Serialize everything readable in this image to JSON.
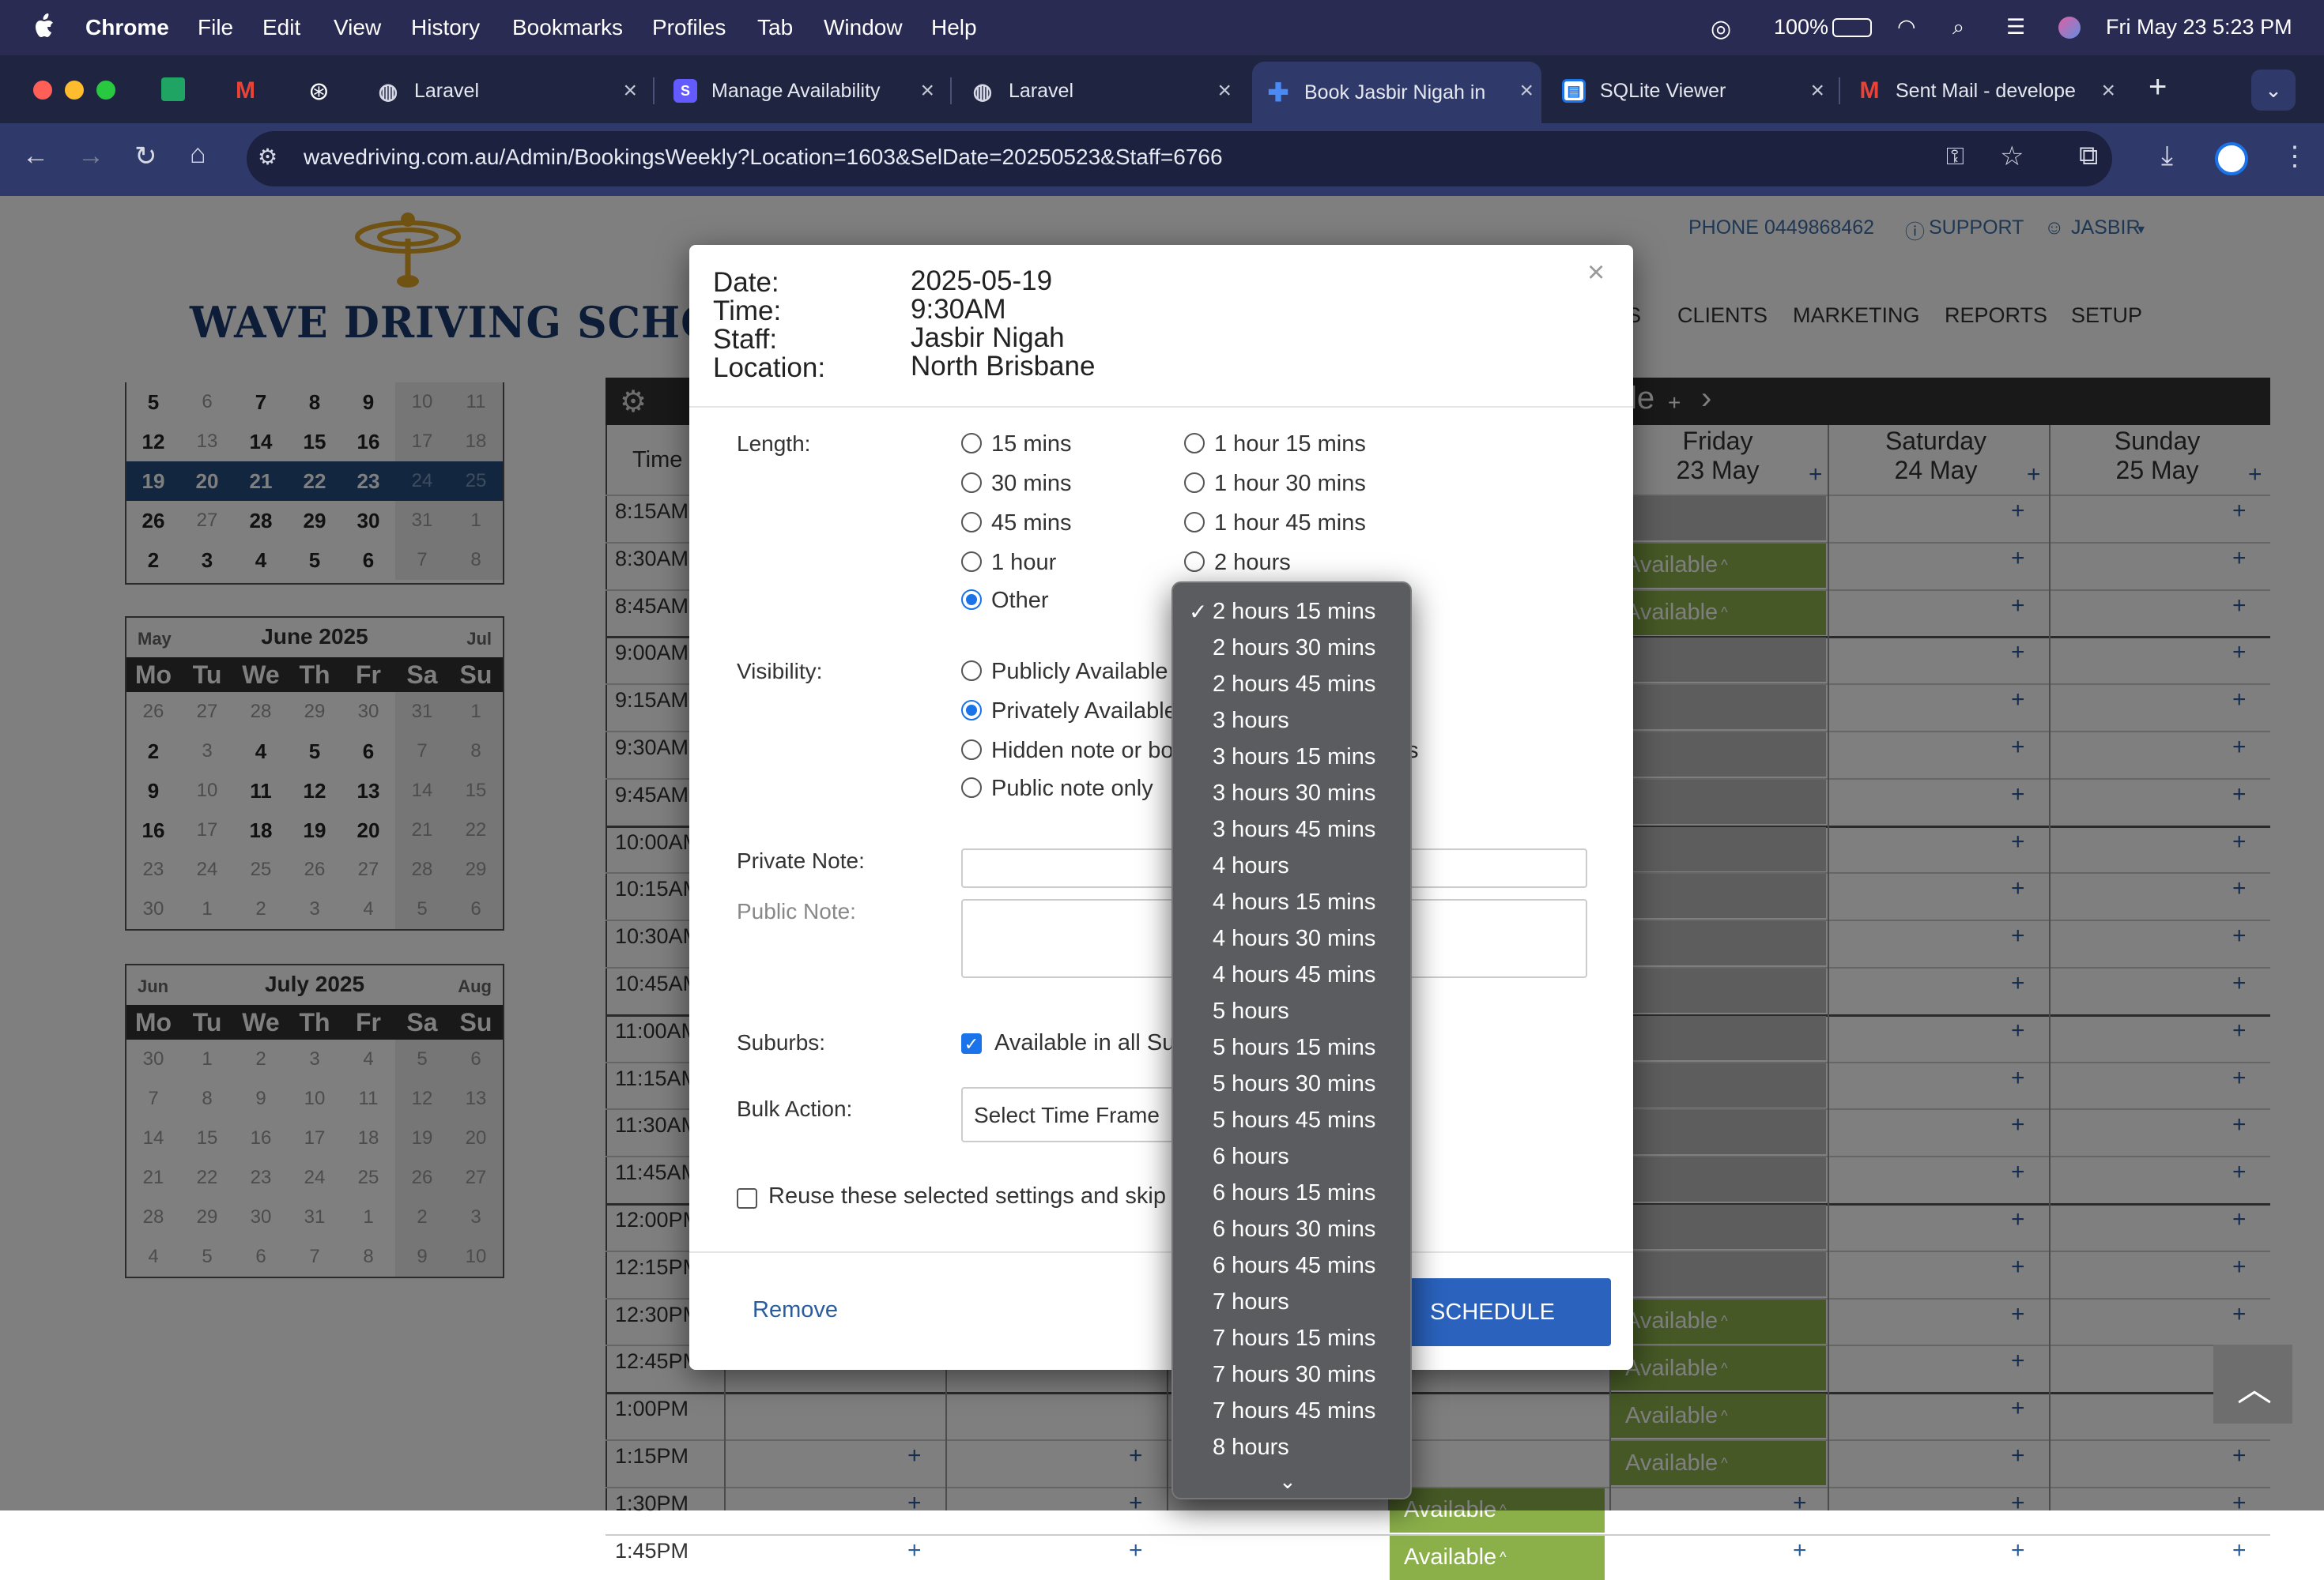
{
  "menubar": {
    "app": "Chrome",
    "items": [
      "File",
      "Edit",
      "View",
      "History",
      "Bookmarks",
      "Profiles",
      "Tab",
      "Window",
      "Help"
    ],
    "battery": "100%",
    "datetime": "Fri May 23  5:23 PM"
  },
  "tabs": [
    {
      "title": "Laravel",
      "favicon": "globe-icon"
    },
    {
      "title": "Manage Availability",
      "favicon": "stripe-icon"
    },
    {
      "title": "Laravel",
      "favicon": "globe-icon"
    },
    {
      "title": "Book Jasbir Nigah in",
      "favicon": "cross-icon",
      "active": true
    },
    {
      "title": "SQLite Viewer",
      "favicon": "doc-icon"
    },
    {
      "title": "Sent Mail - develope",
      "favicon": "gmail-icon"
    }
  ],
  "url": "wavedriving.com.au/Admin/BookingsWeekly?Location=1603&SelDate=20250523&Staff=6766",
  "site": {
    "logo": "WAVE DRIVING SCHOOL",
    "phone_label": "PHONE",
    "phone": "0449868462",
    "support": "SUPPORT",
    "user": "JASBIR",
    "nav": [
      "S",
      "CLIENTS",
      "MARKETING",
      "REPORTS",
      "SETUP"
    ]
  },
  "calendars": {
    "may_rows": [
      [
        "5",
        "6",
        "7",
        "8",
        "9",
        "10",
        "11"
      ],
      [
        "12",
        "13",
        "14",
        "15",
        "16",
        "17",
        "18"
      ],
      [
        "19",
        "20",
        "21",
        "22",
        "23",
        "24",
        "25"
      ],
      [
        "26",
        "27",
        "28",
        "29",
        "30",
        "31",
        "1"
      ],
      [
        "2",
        "3",
        "4",
        "5",
        "6",
        "7",
        "8"
      ]
    ],
    "june": {
      "prev": "May",
      "title": "June 2025",
      "next": "Jul",
      "days": [
        "Mo",
        "Tu",
        "We",
        "Th",
        "Fr",
        "Sa",
        "Su"
      ],
      "rows": [
        [
          "26",
          "27",
          "28",
          "29",
          "30",
          "31",
          "1"
        ],
        [
          "2",
          "3",
          "4",
          "5",
          "6",
          "7",
          "8"
        ],
        [
          "9",
          "10",
          "11",
          "12",
          "13",
          "14",
          "15"
        ],
        [
          "16",
          "17",
          "18",
          "19",
          "20",
          "21",
          "22"
        ],
        [
          "23",
          "24",
          "25",
          "26",
          "27",
          "28",
          "29"
        ],
        [
          "30",
          "1",
          "2",
          "3",
          "4",
          "5",
          "6"
        ]
      ]
    },
    "july": {
      "prev": "Jun",
      "title": "July 2025",
      "next": "Aug",
      "days": [
        "Mo",
        "Tu",
        "We",
        "Th",
        "Fr",
        "Sa",
        "Su"
      ],
      "rows": [
        [
          "30",
          "1",
          "2",
          "3",
          "4",
          "5",
          "6"
        ],
        [
          "7",
          "8",
          "9",
          "10",
          "11",
          "12",
          "13"
        ],
        [
          "14",
          "15",
          "16",
          "17",
          "18",
          "19",
          "20"
        ],
        [
          "21",
          "22",
          "23",
          "24",
          "25",
          "26",
          "27"
        ],
        [
          "28",
          "29",
          "30",
          "31",
          "1",
          "2",
          "3"
        ],
        [
          "4",
          "5",
          "6",
          "7",
          "8",
          "9",
          "10"
        ]
      ]
    }
  },
  "schedule": {
    "header_fragment": "le",
    "time_header": "Time",
    "days": [
      {
        "name": "Friday",
        "date": "23 May"
      },
      {
        "name": "Saturday",
        "date": "24 May"
      },
      {
        "name": "Sunday",
        "date": "25 May"
      }
    ],
    "times": [
      "8:15AM",
      "8:30AM",
      "8:45AM",
      "9:00AM",
      "9:15AM",
      "9:30AM",
      "9:45AM",
      "10:00AM",
      "10:15AM",
      "10:30AM",
      "10:45AM",
      "11:00AM",
      "11:15AM",
      "11:30AM",
      "11:45AM",
      "12:00PM",
      "12:15PM",
      "12:30PM",
      "12:45PM",
      "1:00PM",
      "1:15PM",
      "1:30PM",
      "1:45PM"
    ],
    "available_label": "Available",
    "available_suffix": "^"
  },
  "modal": {
    "date_label": "Date:",
    "date": "2025-05-19",
    "time_label": "Time:",
    "time": "9:30AM",
    "staff_label": "Staff:",
    "staff": "Jasbir Nigah",
    "location_label": "Location:",
    "location": "North Brisbane",
    "length_label": "Length:",
    "length_options_col1": [
      "15 mins",
      "30 mins",
      "45 mins",
      "1 hour",
      "Other"
    ],
    "length_options_col2": [
      "1 hour 15 mins",
      "1 hour 30 mins",
      "1 hour 45 mins",
      "2 hours"
    ],
    "length_selected": "Other",
    "visibility_label": "Visibility:",
    "visibility_options": [
      "Publicly Available",
      "Privately Available",
      "Hidden note or bo",
      "Public note only"
    ],
    "visibility_tail": "ts",
    "visibility_selected": "Privately Available",
    "private_note_label": "Private Note:",
    "public_note_label": "Public Note:",
    "suburbs_label": "Suburbs:",
    "suburbs_checkbox": "Available in all Su",
    "bulk_label": "Bulk Action:",
    "bulk_select": "Select Time Frame",
    "reuse_label": "Reuse these selected settings and skip th",
    "remove": "Remove",
    "schedule_btn": "SCHEDULE",
    "close": "×"
  },
  "dropdown": {
    "selected": "2 hours 15 mins",
    "options": [
      "2 hours 15 mins",
      "2 hours 30 mins",
      "2 hours 45 mins",
      "3 hours",
      "3 hours 15 mins",
      "3 hours 30 mins",
      "3 hours 45 mins",
      "4 hours",
      "4 hours 15 mins",
      "4 hours 30 mins",
      "4 hours 45 mins",
      "5 hours",
      "5 hours 15 mins",
      "5 hours 30 mins",
      "5 hours 45 mins",
      "6 hours",
      "6 hours 15 mins",
      "6 hours 30 mins",
      "6 hours 45 mins",
      "7 hours",
      "7 hours 15 mins",
      "7 hours 30 mins",
      "7 hours 45 mins",
      "8 hours"
    ]
  },
  "colors": {
    "accent": "#2a62bd",
    "available": "#8bb04a",
    "dark_header": "#333333"
  }
}
